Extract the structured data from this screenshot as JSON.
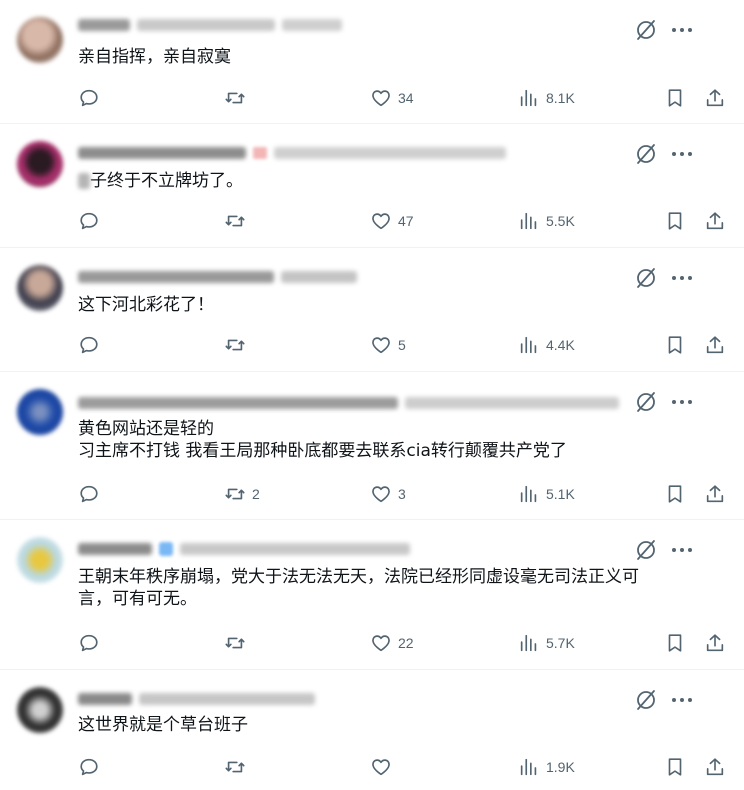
{
  "tweets": [
    {
      "text": [
        "亲自指挥，亲自寂寞"
      ],
      "replies": "",
      "retweets": "",
      "likes": "34",
      "views": "8.1K"
    },
    {
      "text": [
        "子终于不立牌坊了。"
      ],
      "replies": "",
      "retweets": "",
      "likes": "47",
      "views": "5.5K"
    },
    {
      "text": [
        "这下河北彩花了！"
      ],
      "replies": "",
      "retweets": "",
      "likes": "5",
      "views": "4.4K"
    },
    {
      "text": [
        "黄色网站还是轻的",
        "习主席不打钱 我看王局那种卧底都要去联系cia转行颠覆共产党了"
      ],
      "replies": "",
      "retweets": "2",
      "likes": "3",
      "views": "5.1K"
    },
    {
      "text": [
        "王朝末年秩序崩塌，党大于法无法无天，法院已经形同虚设毫无司法正义可",
        "言，可有可无。"
      ],
      "replies": "",
      "retweets": "",
      "likes": "22",
      "views": "5.7K"
    },
    {
      "text": [
        "这世界就是个草台班子"
      ],
      "replies": "",
      "retweets": "",
      "likes": "",
      "views": "1.9K"
    }
  ],
  "icons": {
    "grok": "grok-icon",
    "more": "more-icon",
    "reply": "reply-icon",
    "retweet": "retweet-icon",
    "like": "heart-icon",
    "views": "views-icon",
    "bookmark": "bookmark-icon",
    "share": "share-icon"
  },
  "colors": {
    "icon": "#536471",
    "text": "#0f1419",
    "divider": "#eff3f4"
  }
}
